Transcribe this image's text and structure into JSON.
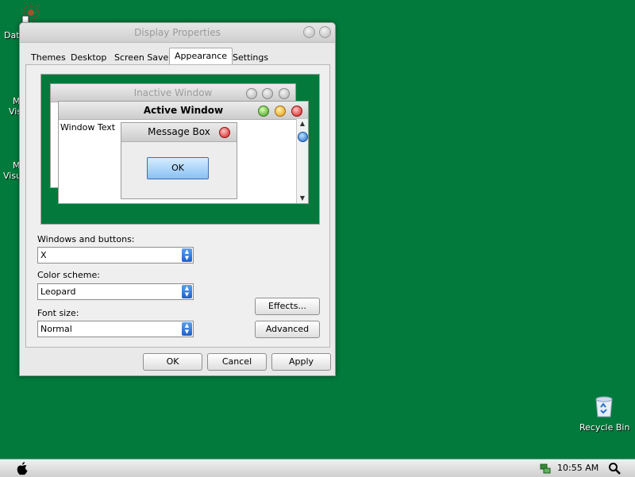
{
  "desktop": {
    "icons": [
      {
        "label_fragment": "Dat"
      },
      {
        "label_fragment": "M"
      },
      {
        "label_fragment": "Visu"
      },
      {
        "label_fragment": "M"
      },
      {
        "label_fragment": "Visu"
      }
    ],
    "recycle_bin": {
      "label": "Recycle Bin",
      "icon": "recycle-bin-icon"
    }
  },
  "dialog": {
    "title": "Display Properties",
    "tabs": [
      "Themes",
      "Desktop",
      "Screen Saver",
      "Appearance",
      "Settings"
    ],
    "active_tab": "Appearance",
    "preview": {
      "inactive_title": "Inactive Window",
      "active_title": "Active Window",
      "window_text": "Window Text",
      "message_box_title": "Message Box",
      "ok_label": "OK"
    },
    "fields": {
      "windows_buttons_label": "Windows and buttons:",
      "windows_buttons_value": "X",
      "color_scheme_label": "Color scheme:",
      "color_scheme_value": "Leopard",
      "font_size_label": "Font size:",
      "font_size_value": "Normal"
    },
    "buttons": {
      "effects": "Effects...",
      "advanced": "Advanced",
      "ok": "OK",
      "cancel": "Cancel",
      "apply": "Apply"
    }
  },
  "taskbar": {
    "start_icon": "apple-icon",
    "clock": "10:55 AM",
    "tray_icon": "network-icon",
    "search_icon": "search-icon"
  },
  "colors": {
    "desktop": "#017A3C",
    "accent_blue": "#1F5FC4"
  }
}
